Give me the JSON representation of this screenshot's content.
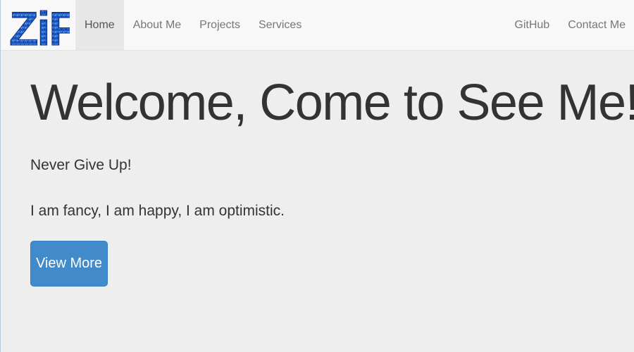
{
  "navbar": {
    "brand_text": "ZiF",
    "left_items": [
      {
        "label": "Home",
        "active": true
      },
      {
        "label": "About Me",
        "active": false
      },
      {
        "label": "Projects",
        "active": false
      },
      {
        "label": "Services",
        "active": false
      }
    ],
    "right_items": [
      {
        "label": "GitHub"
      },
      {
        "label": "Contact Me"
      }
    ]
  },
  "hero": {
    "title": "Welcome, Come to See Me!",
    "tagline": "Never Give Up!",
    "lead": "I am fancy, I am happy, I am optimistic.",
    "button_label": "View More"
  },
  "colors": {
    "navbar_bg": "#f8f8f8",
    "active_nav_bg": "#e7e7e7",
    "page_bg": "#eeeeee",
    "button_bg": "#428bca",
    "logo_blue": "#1f5fc8"
  }
}
